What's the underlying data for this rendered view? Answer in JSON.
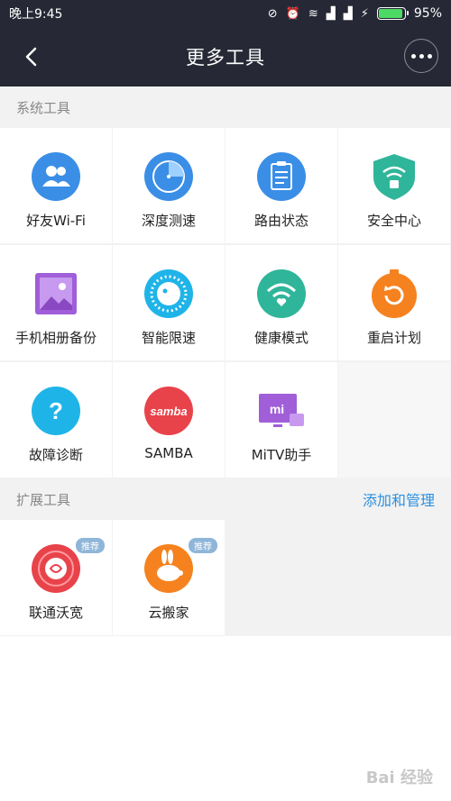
{
  "status_bar": {
    "time": "晚上9:45",
    "battery": "95%",
    "battery_level": 0.95
  },
  "header": {
    "title": "更多工具"
  },
  "system_section": {
    "title": "系统工具"
  },
  "system_tools": [
    {
      "label": "好友Wi-Fi",
      "icon": "friends-wifi-icon"
    },
    {
      "label": "深度测速",
      "icon": "speed-test-icon"
    },
    {
      "label": "路由状态",
      "icon": "router-status-icon"
    },
    {
      "label": "安全中心",
      "icon": "security-shield-icon"
    },
    {
      "label": "手机相册备份",
      "icon": "photo-backup-icon"
    },
    {
      "label": "智能限速",
      "icon": "speed-limit-icon"
    },
    {
      "label": "健康模式",
      "icon": "health-mode-icon"
    },
    {
      "label": "重启计划",
      "icon": "restart-schedule-icon"
    },
    {
      "label": "故障诊断",
      "icon": "diagnosis-icon"
    },
    {
      "label": "SAMBA",
      "icon": "samba-icon",
      "icon_text": "samba"
    },
    {
      "label": "MiTV助手",
      "icon": "mitv-icon",
      "icon_text": "mi"
    }
  ],
  "ext_section": {
    "title": "扩展工具",
    "action": "添加和管理"
  },
  "ext_tools": [
    {
      "label": "联通沃宽",
      "icon": "unicom-icon",
      "badge": "推荐"
    },
    {
      "label": "云搬家",
      "icon": "cloud-move-icon",
      "badge": "推荐"
    }
  ],
  "watermark": "Bai 经验",
  "colors": {
    "bar": "#262835",
    "accent": "#2a8fe0",
    "blue": "#3a8ee6",
    "green": "#2fb59a",
    "orange": "#f5821f",
    "red": "#e8434a",
    "purple": "#a05ed8"
  }
}
